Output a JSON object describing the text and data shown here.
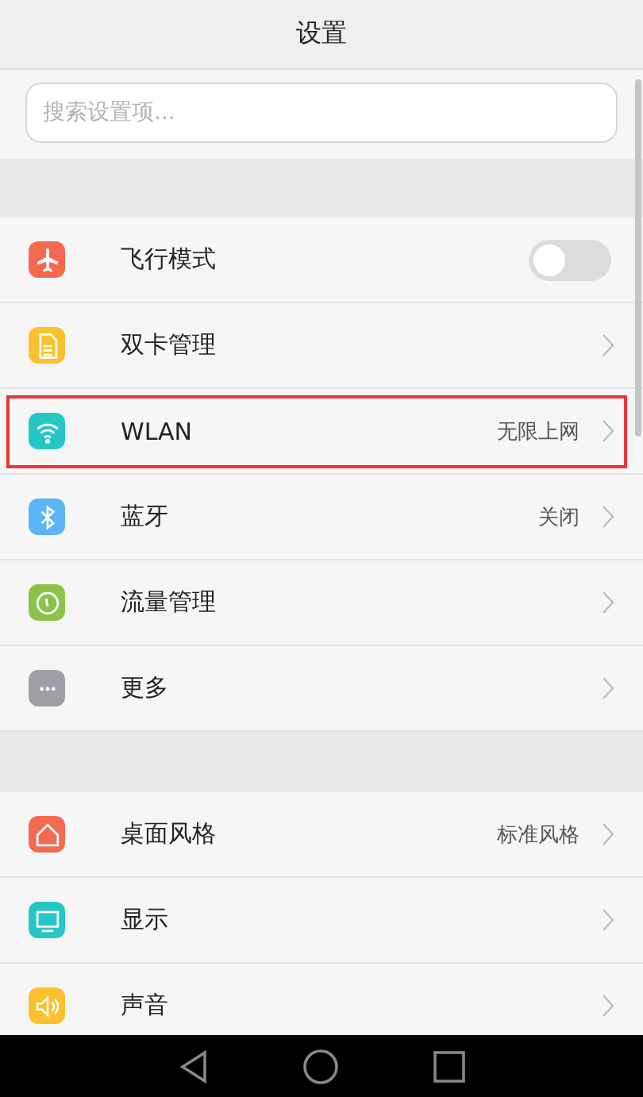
{
  "header": {
    "title": "设置"
  },
  "search": {
    "placeholder": "搜索设置项..."
  },
  "groups": [
    {
      "items": [
        {
          "kind": "toggle",
          "label": "飞行模式",
          "on": false,
          "highlighted": false
        },
        {
          "kind": "link",
          "label": "双卡管理",
          "highlighted": false
        },
        {
          "kind": "link",
          "label": "WLAN",
          "value": "无限上网",
          "highlighted": true
        },
        {
          "kind": "link",
          "label": "蓝牙",
          "value": "关闭",
          "highlighted": false
        },
        {
          "kind": "link",
          "label": "流量管理",
          "highlighted": false
        },
        {
          "kind": "link",
          "label": "更多",
          "highlighted": false
        }
      ]
    },
    {
      "items": [
        {
          "kind": "link",
          "label": "桌面风格",
          "value": "标准风格",
          "highlighted": false
        },
        {
          "kind": "link",
          "label": "显示",
          "highlighted": false
        },
        {
          "kind": "link",
          "label": "声音",
          "highlighted": false
        }
      ]
    }
  ]
}
